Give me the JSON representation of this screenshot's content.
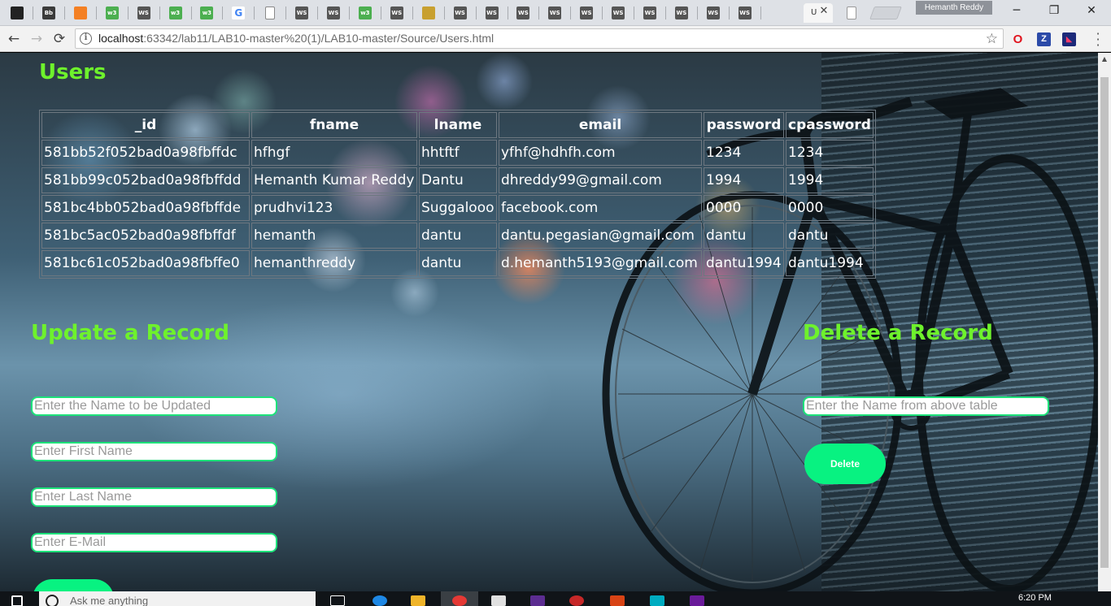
{
  "browser": {
    "profile_name": "Hemanth Reddy",
    "url_host": "localhost",
    "url_path": ":63342/lab11/LAB10-master%20(1)/LAB10-master/Source/Users.html",
    "active_tab_title": "U",
    "tabs": [
      {
        "icon": "github-icon",
        "label": "",
        "color": "#222222"
      },
      {
        "icon": "bb-icon",
        "label": "Bb",
        "color": "#3b3b3b"
      },
      {
        "icon": "bookmark-icon",
        "label": "",
        "color": "#f48024"
      },
      {
        "icon": "w3-icon",
        "label": "w3",
        "color": "#4caf50"
      },
      {
        "icon": "ws-icon",
        "label": "WS",
        "color": "#555555"
      },
      {
        "icon": "w3-icon",
        "label": "w3",
        "color": "#4caf50"
      },
      {
        "icon": "w3-icon",
        "label": "w3",
        "color": "#4caf50"
      },
      {
        "icon": "google-icon",
        "label": "G",
        "color": "#4285f4"
      },
      {
        "icon": "page-icon",
        "label": "",
        "color": "#ffffff"
      },
      {
        "icon": "ws-icon",
        "label": "WS",
        "color": "#555555"
      },
      {
        "icon": "ws-icon",
        "label": "WS",
        "color": "#555555"
      },
      {
        "icon": "w3-icon",
        "label": "w3",
        "color": "#4caf50"
      },
      {
        "icon": "ws-icon",
        "label": "WS",
        "color": "#555555"
      },
      {
        "icon": "lock-icon",
        "label": "",
        "color": "#c8a030"
      },
      {
        "icon": "ws-icon",
        "label": "WS",
        "color": "#555555"
      },
      {
        "icon": "ws-icon",
        "label": "WS",
        "color": "#555555"
      },
      {
        "icon": "ws-icon",
        "label": "WS",
        "color": "#555555"
      },
      {
        "icon": "ws-icon",
        "label": "WS",
        "color": "#555555"
      },
      {
        "icon": "ws-icon",
        "label": "WS",
        "color": "#555555"
      },
      {
        "icon": "ws-icon",
        "label": "WS",
        "color": "#555555"
      },
      {
        "icon": "ws-icon",
        "label": "WS",
        "color": "#555555"
      },
      {
        "icon": "ws-icon",
        "label": "WS",
        "color": "#555555"
      },
      {
        "icon": "ws-icon",
        "label": "WS",
        "color": "#555555"
      },
      {
        "icon": "ws-icon",
        "label": "WS",
        "color": "#555555"
      }
    ]
  },
  "page": {
    "title": "Users",
    "accent_color": "#6ef22c",
    "button_color": "#08f281",
    "table": {
      "headers": [
        "_id",
        "fname",
        "lname",
        "email",
        "password",
        "cpassword"
      ],
      "rows": [
        [
          "581bb52f052bad0a98fbffdc",
          "hfhgf",
          "hhtftf",
          "yfhf@hdhfh.com",
          "1234",
          "1234"
        ],
        [
          "581bb99c052bad0a98fbffdd",
          "Hemanth Kumar Reddy",
          "Dantu",
          "dhreddy99@gmail.com",
          "1994",
          "1994"
        ],
        [
          "581bc4bb052bad0a98fbffde",
          "prudhvi123",
          "Suggalooo",
          "facebook.com",
          "0000",
          "0000"
        ],
        [
          "581bc5ac052bad0a98fbffdf",
          "hemanth",
          "dantu",
          "dantu.pegasian@gmail.com",
          "dantu",
          "dantu"
        ],
        [
          "581bc61c052bad0a98fbffe0",
          "hemanthreddy",
          "dantu",
          "d.hemanth5193@gmail.com",
          "dantu1994",
          "dantu1994"
        ]
      ]
    },
    "update": {
      "title": "Update a Record",
      "name_placeholder": "Enter the Name to be Updated",
      "first_placeholder": "Enter First Name",
      "last_placeholder": "Enter Last Name",
      "email_placeholder": "Enter E-Mail"
    },
    "delete": {
      "title": "Delete a Record",
      "name_placeholder": "Enter the Name from above table",
      "button_label": "Delete"
    }
  },
  "taskbar": {
    "search_text": "Ask me anything",
    "clock": "6:20 PM"
  }
}
